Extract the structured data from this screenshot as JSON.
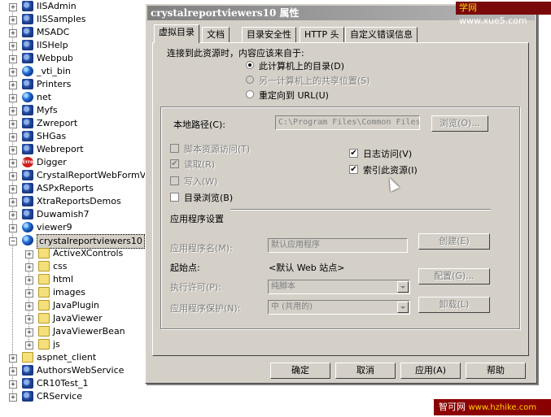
{
  "watermark_top": {
    "brand": "学网",
    "url": "www.xue5.com"
  },
  "watermark_bottom": {
    "brand": "智可网",
    "url": "www.hzhike.com"
  },
  "tree": {
    "nodes": [
      {
        "label": "IISAdmin",
        "icon": "gear-icon",
        "expander": "+"
      },
      {
        "label": "IISSamples",
        "icon": "gear-icon",
        "expander": "+"
      },
      {
        "label": "MSADC",
        "icon": "gear-icon",
        "expander": "+"
      },
      {
        "label": "IISHelp",
        "icon": "gear-icon",
        "expander": "+"
      },
      {
        "label": "Webpub",
        "icon": "gear-icon",
        "expander": "+"
      },
      {
        "label": "_vti_bin",
        "icon": "globe-icon",
        "expander": "+"
      },
      {
        "label": "Printers",
        "icon": "gear-icon",
        "expander": "+"
      },
      {
        "label": "net",
        "icon": "globe-icon",
        "expander": "+"
      },
      {
        "label": "Myfs",
        "icon": "gear-icon",
        "expander": "+"
      },
      {
        "label": "Zwreport",
        "icon": "gear-icon",
        "expander": "+"
      },
      {
        "label": "SHGas",
        "icon": "gear-icon",
        "expander": "+"
      },
      {
        "label": "Webreport",
        "icon": "gear-icon",
        "expander": "+"
      },
      {
        "label": "Digger",
        "icon": "error-icon",
        "expander": "+"
      },
      {
        "label": "CrystalReportWebFormView",
        "icon": "gear-icon",
        "expander": "+"
      },
      {
        "label": "ASPxReports",
        "icon": "gear-icon",
        "expander": "+"
      },
      {
        "label": "XtraReportsDemos",
        "icon": "gear-icon",
        "expander": "+"
      },
      {
        "label": "Duwamish7",
        "icon": "gear-icon",
        "expander": "+"
      },
      {
        "label": "viewer9",
        "icon": "globe-icon",
        "expander": "+"
      },
      {
        "label": "crystalreportviewers10",
        "icon": "globe-icon",
        "expander": "−"
      },
      {
        "label": "ActiveXControls",
        "icon": "folder-icon",
        "expander": "+"
      },
      {
        "label": "css",
        "icon": "folder-icon",
        "expander": "+"
      },
      {
        "label": "html",
        "icon": "folder-icon",
        "expander": "+"
      },
      {
        "label": "images",
        "icon": "folder-icon",
        "expander": "+"
      },
      {
        "label": "JavaPlugin",
        "icon": "folder-icon",
        "expander": "+"
      },
      {
        "label": "JavaViewer",
        "icon": "folder-icon",
        "expander": "+"
      },
      {
        "label": "JavaViewerBean",
        "icon": "folder-icon",
        "expander": "+"
      },
      {
        "label": "js",
        "icon": "folder-icon",
        "expander": "+"
      },
      {
        "label": "aspnet_client",
        "icon": "folder-icon",
        "expander": "+"
      },
      {
        "label": "AuthorsWebService",
        "icon": "gear-icon",
        "expander": "+"
      },
      {
        "label": "CR10Test_1",
        "icon": "gear-icon",
        "expander": "+"
      },
      {
        "label": "CRService",
        "icon": "gear-icon",
        "expander": "+"
      }
    ]
  },
  "dialog": {
    "title": "crystalreportviewers10 属性",
    "tabs": [
      "虚拟目录",
      "文档",
      "目录安全性",
      "HTTP 头",
      "自定义错误信息"
    ],
    "connect_label": "连接到此资源时，内容应该来自于:",
    "source_options": [
      "此计算机上的目录(D)",
      "另一计算机上的共享位置(S)",
      "重定向到 URL(U)"
    ],
    "local_path_label": "本地路径(C):",
    "local_path_value": "C:\\Program Files\\Common Files",
    "browse_button": "浏览(O)...",
    "checks_left": [
      {
        "label": "脚本资源访问(T)",
        "checked": false,
        "disabled": true
      },
      {
        "label": "读取(R)",
        "checked": true,
        "disabled": true
      },
      {
        "label": "写入(W)",
        "checked": false,
        "disabled": true
      },
      {
        "label": "目录浏览(B)",
        "checked": false,
        "disabled": false
      }
    ],
    "checks_right": [
      {
        "label": "日志访问(V)",
        "checked": true
      },
      {
        "label": "索引此资源(I)",
        "checked": true
      }
    ],
    "app_settings_label": "应用程序设置",
    "app_name_label": "应用程序名(M):",
    "app_name_value": "默认应用程序",
    "create_button": "创建(E)",
    "start_point_label": "起始点:",
    "start_point_value": "<默认 Web 站点>",
    "config_button": "配置(G)...",
    "exec_perm_label": "执行许可(P):",
    "exec_perm_value": "纯脚本",
    "app_protect_label": "应用程序保护(N):",
    "app_protect_value": "中 (共用的)",
    "unload_button": "卸载(L)",
    "ok_button": "确定",
    "cancel_button": "取消",
    "apply_button": "应用(A)",
    "help_button": "帮助",
    "check_mark": "✔"
  }
}
